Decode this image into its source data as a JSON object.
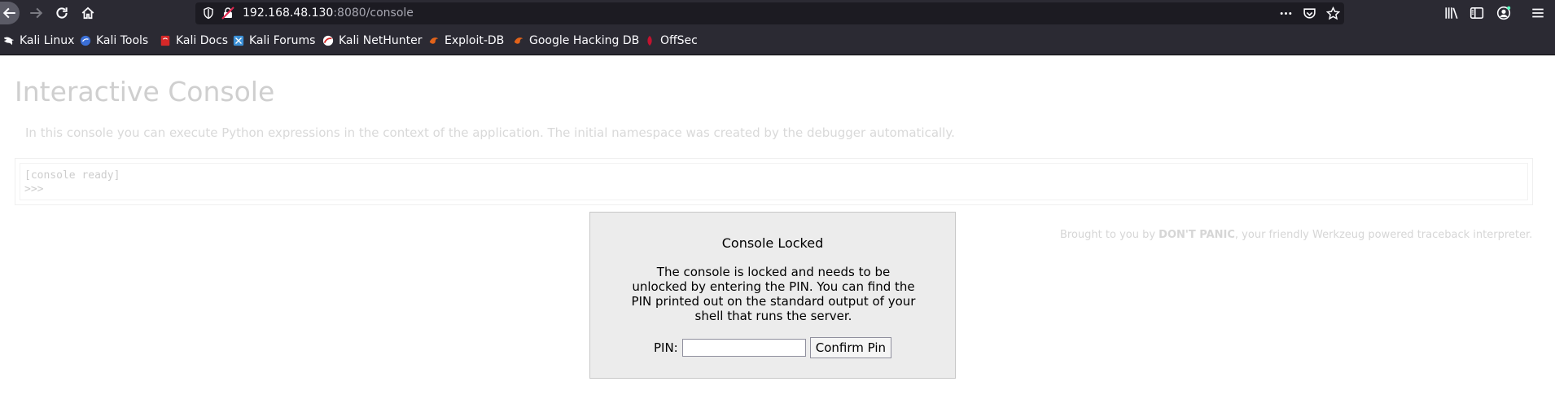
{
  "browser": {
    "url_host": "192.168.48.130",
    "url_rest": ":8080/console",
    "bookmarks": [
      {
        "label": "Kali Linux",
        "color": "#ffffff"
      },
      {
        "label": "Kali Tools",
        "color": "#3b6fd6"
      },
      {
        "label": "Kali Docs",
        "color": "#d62828"
      },
      {
        "label": "Kali Forums",
        "color": "#3b8fd6"
      },
      {
        "label": "Kali NetHunter",
        "color": "#d62828"
      },
      {
        "label": "Exploit-DB",
        "color": "#e2631a"
      },
      {
        "label": "Google Hacking DB",
        "color": "#e2631a"
      },
      {
        "label": "OffSec",
        "color": "#c4122f"
      }
    ]
  },
  "page": {
    "title": "Interactive Console",
    "description": "In this console you can execute Python expressions in the context of the application. The initial namespace was created by the debugger automatically.",
    "console_lines": [
      "[console ready]",
      ">>>"
    ],
    "footer_prefix": "Brought to you by ",
    "footer_bold": "DON'T PANIC",
    "footer_suffix": ", your friendly Werkzeug powered traceback interpreter."
  },
  "dialog": {
    "title": "Console Locked",
    "text": "The console is locked and needs to be unlocked by entering the PIN. You can find the PIN printed out on the standard output of your shell that runs the server.",
    "pin_label": "PIN:",
    "pin_value": "",
    "confirm_label": "Confirm Pin"
  }
}
